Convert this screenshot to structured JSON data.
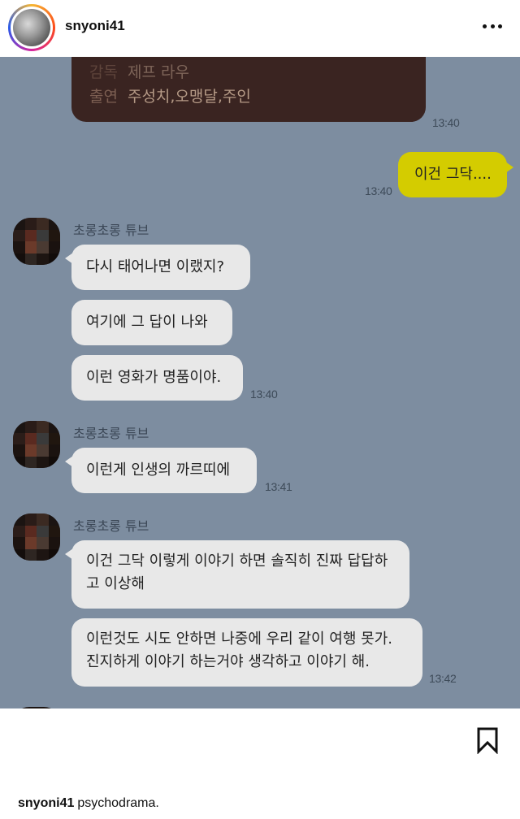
{
  "header": {
    "username": "snyoni41",
    "more_icon": "more-horizontal-icon"
  },
  "chat": {
    "background": "#7d8da0",
    "movie_card": {
      "director_label": "감독",
      "director": "제프 라우",
      "cast_label": "출연",
      "cast": "주성치,오맹달,주인",
      "time": "13:40"
    },
    "outgoing": {
      "text": "이건 그닥....",
      "time": "13:40"
    },
    "groups": [
      {
        "sender": "초롱초롱 튜브",
        "messages": [
          "다시 태어나면 이랬지?",
          "여기에 그 답이 나와",
          "이런 영화가 명품이야."
        ],
        "time": "13:40"
      },
      {
        "sender": "초롱초롱 튜브",
        "messages": [
          "이런게 인생의 까르띠에"
        ],
        "time": "13:41"
      },
      {
        "sender": "초롱초롱 튜브",
        "messages": [
          "이건 그닥 이렇게 이야기 하면 솔직히 진짜 답답하고 이상해",
          "이런것도 시도 안하면 나중에 우리 같이 여행 못가. 진지하게 이야기 하는거야 생각하고 이야기 해."
        ],
        "time": "13:42"
      }
    ]
  },
  "footer": {
    "bookmark_icon": "bookmark-icon",
    "caption_user": "snyoni41",
    "caption_text": "psychodrama."
  }
}
